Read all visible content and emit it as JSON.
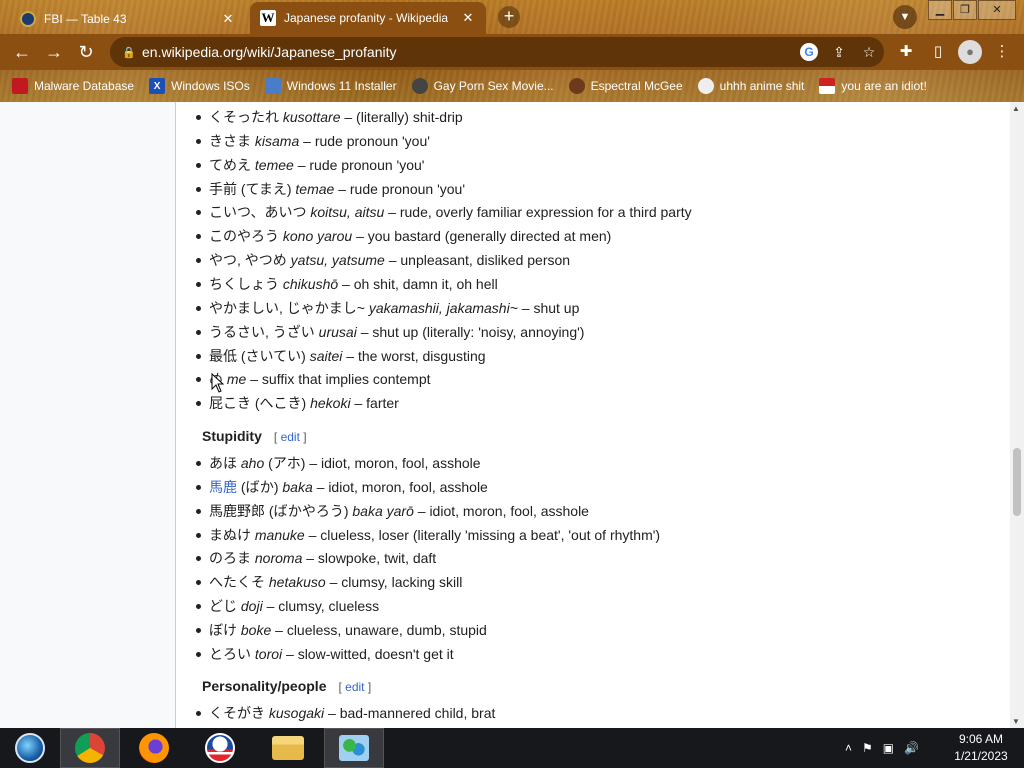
{
  "browser": {
    "tabs": [
      {
        "title": "FBI — Table 43",
        "icon": "fbi-seal-icon"
      },
      {
        "title": "Japanese profanity - Wikipedia",
        "icon": "wikipedia-icon"
      }
    ],
    "address": "en.wikipedia.org/wiki/Japanese_profanity",
    "bookmarks": [
      "Malware Database",
      "Windows ISOs",
      "Windows 11 Installer",
      "Gay Porn Sex Movie...",
      "Espectral McGee",
      "uhhh anime shit",
      "you are an idiot!"
    ],
    "accent_color": "#8b4f12"
  },
  "page": {
    "insult_items": [
      {
        "jp": "くそったれ",
        "ro": "kusottare",
        "def": "– (literally) shit-drip"
      },
      {
        "jp": "きさま",
        "ro": "kisama",
        "def": "– rude pronoun 'you'"
      },
      {
        "jp": "てめえ",
        "ro": "temee",
        "def": "– rude pronoun 'you'"
      },
      {
        "jp": "手前 (てまえ)",
        "ro": "temae",
        "def": "– rude pronoun 'you'"
      },
      {
        "jp": "こいつ、あいつ",
        "ro": "koitsu, aitsu",
        "def": "– rude, overly familiar expression for a third party"
      },
      {
        "jp": "このやろう",
        "ro": "kono yarou",
        "def": "– you bastard (generally directed at men)"
      },
      {
        "jp": "やつ, やつめ",
        "ro": "yatsu, yatsume",
        "def": "– unpleasant, disliked person"
      },
      {
        "jp": "ちくしょう",
        "ro": "chikushō",
        "def": "– oh shit, damn it, oh hell"
      },
      {
        "jp": "やかましい, じゃかまし~",
        "ro": "yakamashii, jakamashi~",
        "def": "– shut up"
      },
      {
        "jp": "うるさい, うざい",
        "ro": "urusai",
        "def": "– shut up (literally: 'noisy, annoying')"
      },
      {
        "jp": "最低 (さいてい)",
        "ro": "saitei",
        "def": "– the worst, disgusting"
      },
      {
        "jp": "め",
        "ro": "me",
        "def": "– suffix that implies contempt"
      },
      {
        "jp": "屁こき (へこき)",
        "ro": "hekoki",
        "def": "– farter"
      }
    ],
    "stupidity": {
      "heading": "Stupidity",
      "edit_label": "edit",
      "items": [
        {
          "jp": "あほ",
          "ro": "aho",
          "jp2": "(アホ)",
          "def": "– idiot, moron, fool, asshole"
        },
        {
          "jp": "",
          "link": "馬鹿",
          "jp2": "(ばか)",
          "ro": "baka",
          "def": "– idiot, moron, fool, asshole"
        },
        {
          "jp": "馬鹿野郎 (ばかやろう)",
          "ro": "baka yarō",
          "def": "– idiot, moron, fool, asshole"
        },
        {
          "jp": "まぬけ",
          "ro": "manuke",
          "def": "– clueless, loser (literally 'missing a beat', 'out of rhythm')"
        },
        {
          "jp": "のろま",
          "ro": "noroma",
          "def": "– slowpoke, twit, daft"
        },
        {
          "jp": "へたくそ",
          "ro": "hetakuso",
          "def": "– clumsy, lacking skill"
        },
        {
          "jp": "どじ",
          "ro": "doji",
          "def": "– clumsy, clueless"
        },
        {
          "jp": "ぼけ",
          "ro": "boke",
          "def": "– clueless, unaware, dumb, stupid"
        },
        {
          "jp": "とろい",
          "ro": "toroi",
          "def": "– slow-witted, doesn't get it"
        }
      ]
    },
    "personality": {
      "heading": "Personality/people",
      "edit_label": "edit",
      "items": [
        {
          "jp": "くそがき",
          "ro": "kusogaki",
          "def": "– bad-mannered child, brat"
        }
      ]
    }
  },
  "taskbar": {
    "apps": [
      "start-orb-icon",
      "chrome-icon",
      "firefox-icon",
      "obama-logo-icon",
      "file-explorer-icon",
      "network-people-icon"
    ],
    "time": "9:06 AM",
    "date": "1/21/2023"
  }
}
